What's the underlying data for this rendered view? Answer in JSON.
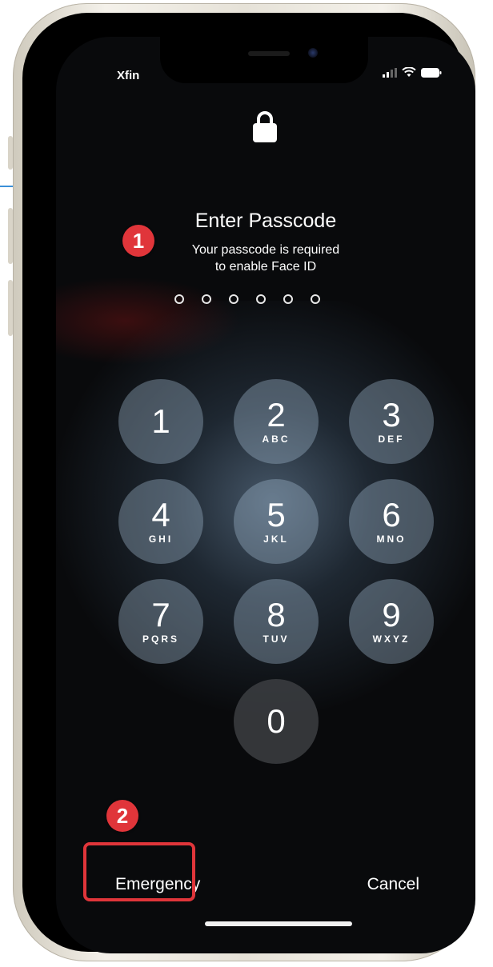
{
  "status_bar": {
    "carrier": "Xfin"
  },
  "prompt": {
    "title": "Enter Passcode",
    "subtitle_line1": "Your passcode is required",
    "subtitle_line2": "to enable Face ID"
  },
  "passcode": {
    "length": 6,
    "entered": 0
  },
  "keypad": [
    {
      "num": "1",
      "letters": ""
    },
    {
      "num": "2",
      "letters": "ABC"
    },
    {
      "num": "3",
      "letters": "DEF"
    },
    {
      "num": "4",
      "letters": "GHI"
    },
    {
      "num": "5",
      "letters": "JKL"
    },
    {
      "num": "6",
      "letters": "MNO"
    },
    {
      "num": "7",
      "letters": "PQRS"
    },
    {
      "num": "8",
      "letters": "TUV"
    },
    {
      "num": "9",
      "letters": "WXYZ"
    },
    {
      "num": "0",
      "letters": ""
    }
  ],
  "actions": {
    "emergency": "Emergency",
    "cancel": "Cancel"
  },
  "annotations": {
    "step1": "1",
    "step2": "2"
  },
  "colors": {
    "annotation_red": "#e0353a",
    "key_fill": "#a0b9cd"
  }
}
